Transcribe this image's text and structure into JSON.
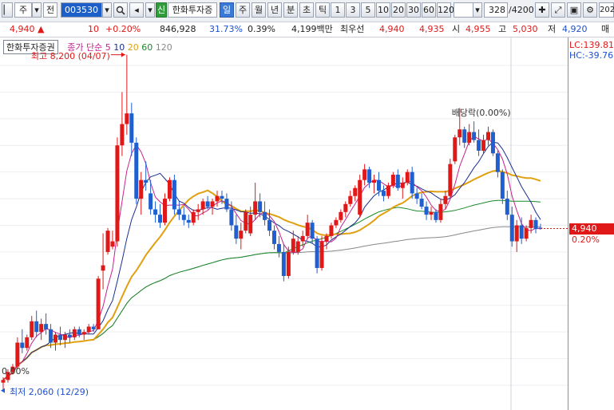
{
  "toolbar": {
    "market": "주",
    "period_type": "전",
    "code": "003530",
    "badge": "신",
    "stock_name": "한화투자증",
    "periods": [
      "일",
      "주",
      "월",
      "년",
      "분",
      "초",
      "틱"
    ],
    "intervals": [
      "1",
      "3",
      "5",
      "10",
      "20",
      "30",
      "60",
      "120"
    ],
    "count": "328",
    "total": "/4200",
    "cut_text": "202"
  },
  "quote": {
    "price": "4,940 ▲",
    "change": "10",
    "change_pct": "+0.20%",
    "volume": "846,928",
    "turnover": "31.73%",
    "ratio": "0.39%",
    "amount": "4,199백만",
    "label_best": "최우선",
    "ask": "4,940",
    "bid": "4,935",
    "open_label": "시",
    "open": "4,955",
    "high_label": "고",
    "high": "5,030",
    "low_label": "저",
    "low": "4,920",
    "sell_label": "매"
  },
  "legend": {
    "stock": "한화투자증권",
    "ma_label": "종가 단순",
    "ma5": "5",
    "ma10": "10",
    "ma20": "20",
    "ma60": "60",
    "ma120": "120"
  },
  "annotations": {
    "high_label": "최고 8,200 (04/07)",
    "low_label": "최저 2,060 (12/29)",
    "ex_dividend": "배당락(0.00%)",
    "left_pct": "0.00%"
  },
  "right_panel": {
    "lc": "LC:139.81",
    "hc": "HC:-39.76",
    "last_price": "4,940",
    "last_pct": "0.20%"
  },
  "colors": {
    "up": "#e01818",
    "down": "#1f5fd0",
    "ma5": "#c8228f",
    "ma10": "#1a2f8f",
    "ma20": "#e0a010",
    "ma60": "#1a8a2a",
    "ma120": "#888888"
  },
  "chart_data": {
    "type": "candlestick",
    "y_axis_ticks": [
      2000,
      2500,
      3000,
      3500,
      4000,
      4500,
      5000,
      5500,
      6000,
      6500,
      7000,
      7500,
      8000
    ],
    "ylim": [
      1600,
      8250
    ],
    "y_axis_side": "right",
    "grid": true,
    "moving_averages": [
      "5",
      "10",
      "20",
      "60",
      "120"
    ],
    "high_marker": {
      "value": 8200,
      "date": "04/07"
    },
    "low_marker": {
      "value": 2060,
      "date": "12/29"
    },
    "last": {
      "close": 4940,
      "change_pct": 0.2
    },
    "candles": [
      {
        "o": 2050,
        "h": 2150,
        "l": 1900,
        "c": 2100
      },
      {
        "o": 2100,
        "h": 2300,
        "l": 2050,
        "c": 2250
      },
      {
        "o": 2250,
        "h": 2400,
        "l": 2200,
        "c": 2350
      },
      {
        "o": 2350,
        "h": 2900,
        "l": 2300,
        "c": 2800
      },
      {
        "o": 2800,
        "h": 3050,
        "l": 2600,
        "c": 2700
      },
      {
        "o": 2700,
        "h": 2950,
        "l": 2650,
        "c": 2900
      },
      {
        "o": 2900,
        "h": 3300,
        "l": 2850,
        "c": 3200
      },
      {
        "o": 3200,
        "h": 3400,
        "l": 2900,
        "c": 3000
      },
      {
        "o": 3000,
        "h": 3250,
        "l": 2850,
        "c": 3150
      },
      {
        "o": 3150,
        "h": 3350,
        "l": 2950,
        "c": 3050
      },
      {
        "o": 3050,
        "h": 3150,
        "l": 2700,
        "c": 2800
      },
      {
        "o": 2800,
        "h": 3000,
        "l": 2650,
        "c": 2950
      },
      {
        "o": 2950,
        "h": 3100,
        "l": 2750,
        "c": 2850
      },
      {
        "o": 2850,
        "h": 3000,
        "l": 2700,
        "c": 2950
      },
      {
        "o": 2950,
        "h": 3050,
        "l": 2800,
        "c": 2900
      },
      {
        "o": 2900,
        "h": 3100,
        "l": 2850,
        "c": 3050
      },
      {
        "o": 3050,
        "h": 3100,
        "l": 2900,
        "c": 2950
      },
      {
        "o": 2950,
        "h": 3050,
        "l": 2850,
        "c": 3000
      },
      {
        "o": 3000,
        "h": 3150,
        "l": 2950,
        "c": 3100
      },
      {
        "o": 3100,
        "h": 3150,
        "l": 3000,
        "c": 3050
      },
      {
        "o": 3050,
        "h": 4050,
        "l": 3050,
        "c": 4000
      },
      {
        "o": 4150,
        "h": 4850,
        "l": 3800,
        "c": 4250
      },
      {
        "o": 4500,
        "h": 4950,
        "l": 4450,
        "c": 4900
      },
      {
        "o": 4600,
        "h": 4900,
        "l": 4550,
        "c": 4700
      },
      {
        "o": 4700,
        "h": 6650,
        "l": 4600,
        "c": 6500
      },
      {
        "o": 6500,
        "h": 7500,
        "l": 6300,
        "c": 6900
      },
      {
        "o": 6900,
        "h": 8200,
        "l": 6700,
        "c": 7100
      },
      {
        "o": 7100,
        "h": 7300,
        "l": 6300,
        "c": 6550
      },
      {
        "o": 6550,
        "h": 6650,
        "l": 5400,
        "c": 5500
      },
      {
        "o": 5500,
        "h": 6000,
        "l": 5200,
        "c": 5850
      },
      {
        "o": 5850,
        "h": 6200,
        "l": 5650,
        "c": 5800
      },
      {
        "o": 5600,
        "h": 5850,
        "l": 5200,
        "c": 5300
      },
      {
        "o": 5300,
        "h": 5450,
        "l": 5050,
        "c": 5200
      },
      {
        "o": 5200,
        "h": 5400,
        "l": 4950,
        "c": 5050
      },
      {
        "o": 5050,
        "h": 5600,
        "l": 5000,
        "c": 5500
      },
      {
        "o": 5500,
        "h": 5900,
        "l": 5450,
        "c": 5850
      },
      {
        "o": 5850,
        "h": 5950,
        "l": 5200,
        "c": 5300
      },
      {
        "o": 5300,
        "h": 5450,
        "l": 5100,
        "c": 5200
      },
      {
        "o": 5200,
        "h": 5350,
        "l": 5000,
        "c": 5100
      },
      {
        "o": 5100,
        "h": 5200,
        "l": 4950,
        "c": 5050
      },
      {
        "o": 5050,
        "h": 5300,
        "l": 5000,
        "c": 5250
      },
      {
        "o": 5250,
        "h": 5400,
        "l": 5100,
        "c": 5300
      },
      {
        "o": 5300,
        "h": 5500,
        "l": 5200,
        "c": 5450
      },
      {
        "o": 5450,
        "h": 5550,
        "l": 5300,
        "c": 5350
      },
      {
        "o": 5350,
        "h": 5500,
        "l": 5200,
        "c": 5450
      },
      {
        "o": 5450,
        "h": 5650,
        "l": 5350,
        "c": 5550
      },
      {
        "o": 5550,
        "h": 5650,
        "l": 5400,
        "c": 5500
      },
      {
        "o": 5500,
        "h": 5600,
        "l": 5250,
        "c": 5300
      },
      {
        "o": 5300,
        "h": 5450,
        "l": 4900,
        "c": 5000
      },
      {
        "o": 5000,
        "h": 5200,
        "l": 4650,
        "c": 4750
      },
      {
        "o": 4750,
        "h": 5050,
        "l": 4550,
        "c": 4900
      },
      {
        "o": 4900,
        "h": 5300,
        "l": 4850,
        "c": 5250
      },
      {
        "o": 4850,
        "h": 5350,
        "l": 4800,
        "c": 5200
      },
      {
        "o": 5200,
        "h": 5800,
        "l": 5100,
        "c": 5450
      },
      {
        "o": 5450,
        "h": 5600,
        "l": 5150,
        "c": 5250
      },
      {
        "o": 5250,
        "h": 5450,
        "l": 5000,
        "c": 5100
      },
      {
        "o": 5100,
        "h": 5300,
        "l": 4800,
        "c": 4900
      },
      {
        "o": 4900,
        "h": 5000,
        "l": 4550,
        "c": 4650
      },
      {
        "o": 4650,
        "h": 4800,
        "l": 4400,
        "c": 4500
      },
      {
        "o": 4500,
        "h": 4650,
        "l": 3950,
        "c": 4050
      },
      {
        "o": 4050,
        "h": 4600,
        "l": 4000,
        "c": 4500
      },
      {
        "o": 4500,
        "h": 4900,
        "l": 4450,
        "c": 4750
      },
      {
        "o": 4500,
        "h": 4800,
        "l": 4450,
        "c": 4700
      },
      {
        "o": 4700,
        "h": 4900,
        "l": 4600,
        "c": 4800
      },
      {
        "o": 4800,
        "h": 5200,
        "l": 4750,
        "c": 5050
      },
      {
        "o": 5050,
        "h": 5100,
        "l": 4650,
        "c": 4750
      },
      {
        "o": 4750,
        "h": 4800,
        "l": 4100,
        "c": 4200
      },
      {
        "o": 4200,
        "h": 4800,
        "l": 4150,
        "c": 4700
      },
      {
        "o": 4700,
        "h": 4850,
        "l": 4550,
        "c": 4800
      },
      {
        "o": 4800,
        "h": 5050,
        "l": 4750,
        "c": 5000
      },
      {
        "o": 5000,
        "h": 5150,
        "l": 4950,
        "c": 5100
      },
      {
        "o": 5100,
        "h": 5300,
        "l": 5050,
        "c": 5250
      },
      {
        "o": 5250,
        "h": 5450,
        "l": 5150,
        "c": 5400
      },
      {
        "o": 5400,
        "h": 5650,
        "l": 5350,
        "c": 5550
      },
      {
        "o": 5550,
        "h": 5750,
        "l": 5450,
        "c": 5700
      },
      {
        "o": 5200,
        "h": 5950,
        "l": 5150,
        "c": 5850
      },
      {
        "o": 5850,
        "h": 6150,
        "l": 5750,
        "c": 6050
      },
      {
        "o": 6050,
        "h": 6100,
        "l": 5700,
        "c": 5800
      },
      {
        "o": 5800,
        "h": 5950,
        "l": 5600,
        "c": 5850
      },
      {
        "o": 5850,
        "h": 6000,
        "l": 5550,
        "c": 5650
      },
      {
        "o": 5650,
        "h": 5750,
        "l": 5450,
        "c": 5550
      },
      {
        "o": 5550,
        "h": 5800,
        "l": 5500,
        "c": 5750
      },
      {
        "o": 5750,
        "h": 6000,
        "l": 5700,
        "c": 5950
      },
      {
        "o": 5950,
        "h": 6050,
        "l": 5650,
        "c": 5700
      },
      {
        "o": 5700,
        "h": 5900,
        "l": 5500,
        "c": 5800
      },
      {
        "o": 5800,
        "h": 6050,
        "l": 5750,
        "c": 6000
      },
      {
        "o": 6000,
        "h": 6100,
        "l": 5500,
        "c": 5600
      },
      {
        "o": 5600,
        "h": 5700,
        "l": 5400,
        "c": 5500
      },
      {
        "o": 5500,
        "h": 5600,
        "l": 5300,
        "c": 5350
      },
      {
        "o": 5350,
        "h": 5450,
        "l": 5100,
        "c": 5200
      },
      {
        "o": 5200,
        "h": 5350,
        "l": 5100,
        "c": 5250
      },
      {
        "o": 5250,
        "h": 5300,
        "l": 5050,
        "c": 5100
      },
      {
        "o": 5100,
        "h": 5500,
        "l": 5050,
        "c": 5400
      },
      {
        "o": 5400,
        "h": 5650,
        "l": 5300,
        "c": 5550
      },
      {
        "o": 5550,
        "h": 6250,
        "l": 5500,
        "c": 6150
      },
      {
        "o": 6200,
        "h": 6700,
        "l": 6150,
        "c": 6650
      },
      {
        "o": 6650,
        "h": 7200,
        "l": 6500,
        "c": 6800
      },
      {
        "o": 6800,
        "h": 6850,
        "l": 6450,
        "c": 6550
      },
      {
        "o": 6550,
        "h": 6900,
        "l": 6500,
        "c": 6750
      },
      {
        "o": 6750,
        "h": 6950,
        "l": 6550,
        "c": 6600
      },
      {
        "o": 6600,
        "h": 6800,
        "l": 6300,
        "c": 6400
      },
      {
        "o": 6400,
        "h": 6700,
        "l": 6350,
        "c": 6600
      },
      {
        "o": 6600,
        "h": 6850,
        "l": 6500,
        "c": 6750
      },
      {
        "o": 6750,
        "h": 6800,
        "l": 6300,
        "c": 6350
      },
      {
        "o": 6350,
        "h": 6400,
        "l": 5900,
        "c": 6000
      },
      {
        "o": 6000,
        "h": 6050,
        "l": 5400,
        "c": 5500
      },
      {
        "o": 5500,
        "h": 5650,
        "l": 5100,
        "c": 5200
      },
      {
        "o": 5200,
        "h": 5350,
        "l": 4600,
        "c": 4700
      },
      {
        "o": 4700,
        "h": 5100,
        "l": 4500,
        "c": 5000
      },
      {
        "o": 5000,
        "h": 5150,
        "l": 4650,
        "c": 4750
      },
      {
        "o": 4750,
        "h": 5000,
        "l": 4700,
        "c": 4950
      },
      {
        "o": 4950,
        "h": 5200,
        "l": 4850,
        "c": 5100
      },
      {
        "o": 5100,
        "h": 5150,
        "l": 4850,
        "c": 4930
      },
      {
        "o": 4955,
        "h": 5030,
        "l": 4920,
        "c": 4940
      }
    ]
  }
}
